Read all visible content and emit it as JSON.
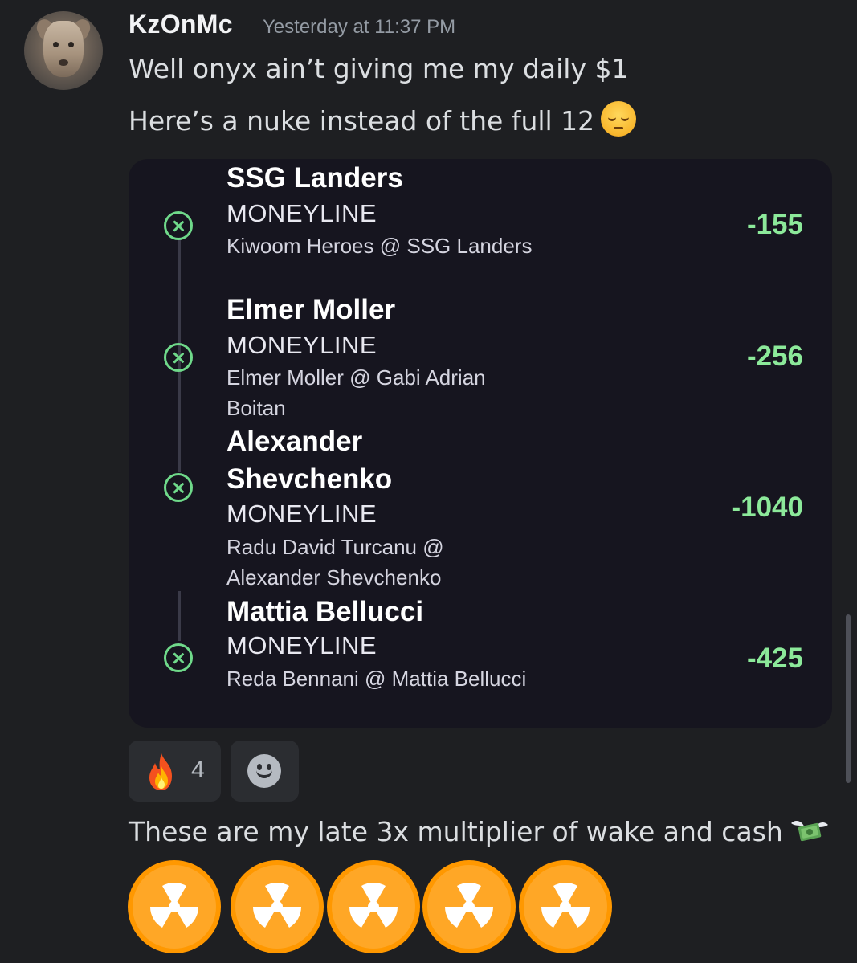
{
  "message": {
    "username": "KzOnMc",
    "timestamp": "Yesterday at 11:37 PM",
    "line1": "Well onyx ain’t giving me my daily $1",
    "line2": "Here’s a nuke instead of the full 12",
    "line2_emoji": "pensive-face",
    "line3": "These are my late 3x multiplier of wake and cash",
    "line3_emoji": "money-with-wings",
    "nuke_emoji_count": 5,
    "nuke_emoji": "radioactive-face"
  },
  "bet_slip": {
    "legs": [
      {
        "name": "SSG Landers",
        "type": "MONEYLINE",
        "match": "Kiwoom Heroes @ SSG Landers",
        "odds": "-155",
        "status": "lost"
      },
      {
        "name": "Elmer Moller",
        "type": "MONEYLINE",
        "match": "Elmer Moller @ Gabi Adrian Boitan",
        "odds": "-256",
        "status": "lost"
      },
      {
        "name": "Alexander Shevchenko",
        "type": "MONEYLINE",
        "match": "Radu David Turcanu @ Alexander Shevchenko",
        "odds": "-1040",
        "status": "lost"
      },
      {
        "name": "Mattia Bellucci",
        "type": "MONEYLINE",
        "match": "Reda Bennani @ Mattia Bellucci",
        "odds": "-425",
        "status": "lost"
      }
    ],
    "accent_color": "#8ce99a"
  },
  "reactions": [
    {
      "emoji": "fire",
      "count": "4"
    }
  ],
  "add_reaction_icon": "smile-icon",
  "colors": {
    "background": "#1e1f22",
    "card": "#16151f",
    "odds_green": "#8ce99a"
  }
}
